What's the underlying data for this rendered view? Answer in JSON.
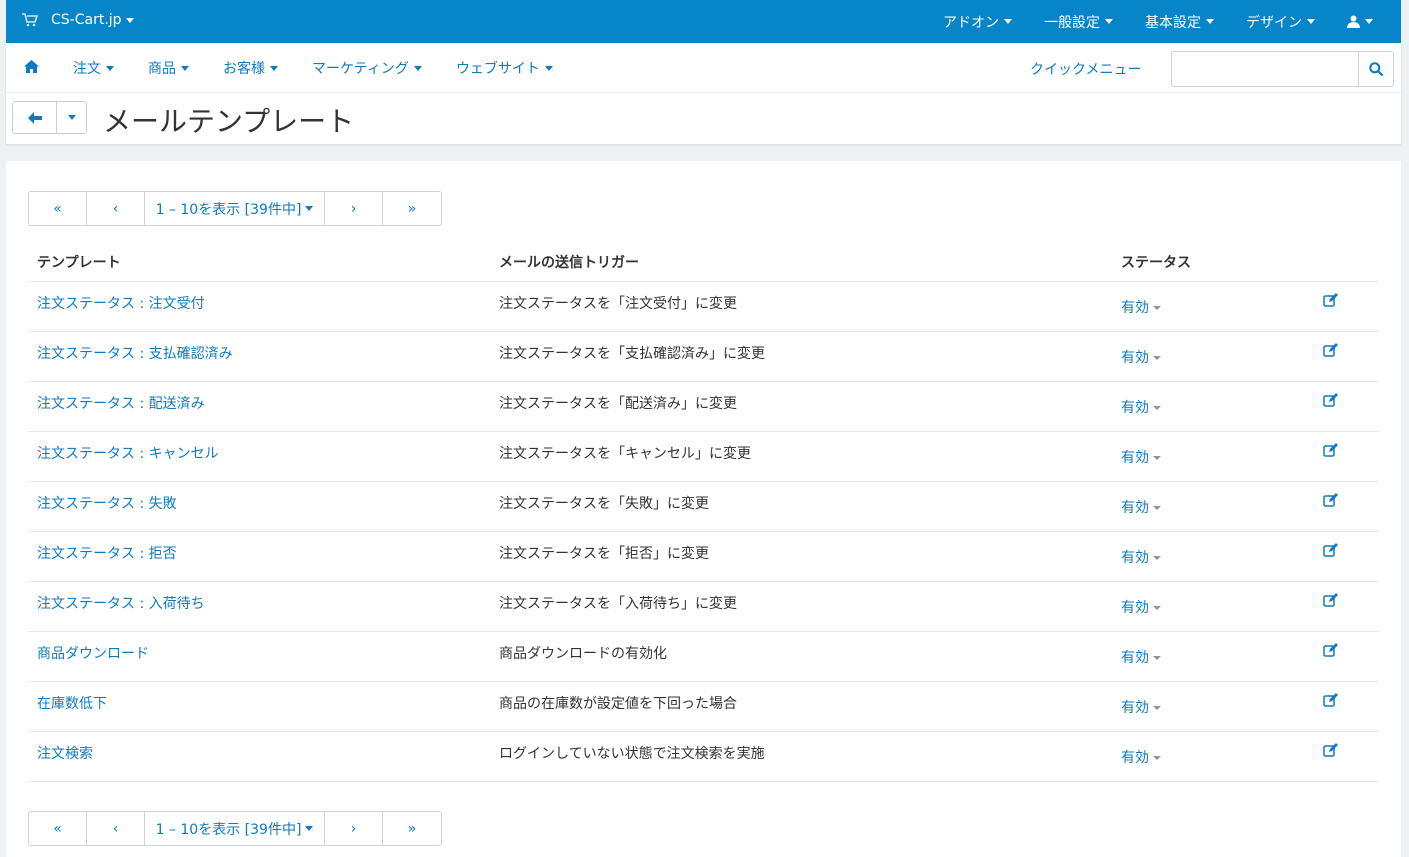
{
  "topbar": {
    "brand": "CS-Cart.jp",
    "menu": [
      "アドオン",
      "一般設定",
      "基本設定",
      "デザイン"
    ]
  },
  "nav": {
    "items": [
      "注文",
      "商品",
      "お客様",
      "マーケティング",
      "ウェブサイト"
    ],
    "quick_menu": "クイックメニュー",
    "search_placeholder": ""
  },
  "page": {
    "title": "メールテンプレート"
  },
  "pagination": {
    "first": "«",
    "prev": "‹",
    "range": "1 – 10を表示 [39件中]",
    "next": "›",
    "last": "»"
  },
  "table": {
    "headers": [
      "テンプレート",
      "メールの送信トリガー",
      "ステータス"
    ],
    "rows": [
      {
        "template": "注文ステータス : 注文受付",
        "trigger": "注文ステータスを「注文受付」に変更",
        "status": "有効"
      },
      {
        "template": "注文ステータス : 支払確認済み",
        "trigger": "注文ステータスを「支払確認済み」に変更",
        "status": "有効"
      },
      {
        "template": "注文ステータス : 配送済み",
        "trigger": "注文ステータスを「配送済み」に変更",
        "status": "有効"
      },
      {
        "template": "注文ステータス : キャンセル",
        "trigger": "注文ステータスを「キャンセル」に変更",
        "status": "有効"
      },
      {
        "template": "注文ステータス : 失敗",
        "trigger": "注文ステータスを「失敗」に変更",
        "status": "有効"
      },
      {
        "template": "注文ステータス : 拒否",
        "trigger": "注文ステータスを「拒否」に変更",
        "status": "有効"
      },
      {
        "template": "注文ステータス : 入荷待ち",
        "trigger": "注文ステータスを「入荷待ち」に変更",
        "status": "有効"
      },
      {
        "template": "商品ダウンロード",
        "trigger": "商品ダウンロードの有効化",
        "status": "有効"
      },
      {
        "template": "在庫数低下",
        "trigger": "商品の在庫数が設定値を下回った場合",
        "status": "有効"
      },
      {
        "template": "注文検索",
        "trigger": "ログインしていない状態で注文検索を実施",
        "status": "有効"
      }
    ]
  },
  "colors": {
    "topbar": "#0685c8",
    "link": "#0f7ac0",
    "background": "#eef1f4"
  }
}
